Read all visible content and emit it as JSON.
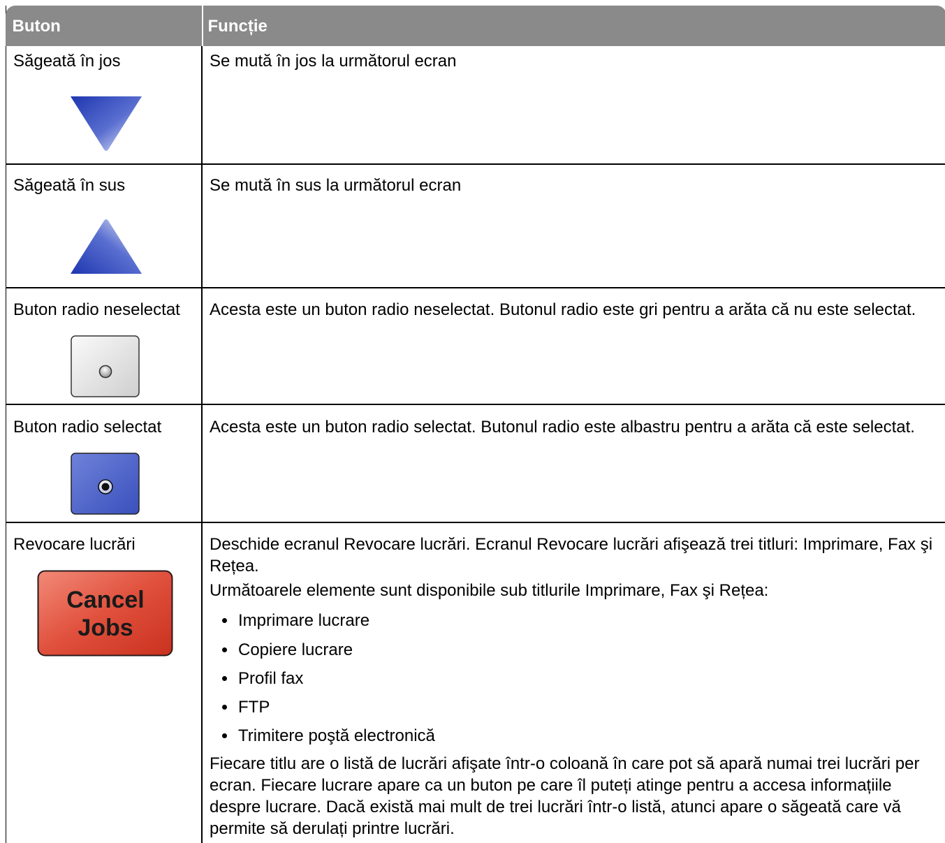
{
  "table": {
    "headers": [
      "Buton",
      "Funcție"
    ],
    "rows": [
      {
        "button_label": "Săgeată în jos",
        "icon": "arrow-down-icon",
        "function": [
          "Se mută în jos la următorul ecran"
        ]
      },
      {
        "button_label": "Săgeată în sus",
        "icon": "arrow-up-icon",
        "function": [
          "Se mută în sus la următorul ecran"
        ]
      },
      {
        "button_label": "Buton radio neselectat",
        "icon": "radio-unselected-icon",
        "function": [
          "Acesta este un buton radio neselectat. Butonul radio este gri pentru a arăta că nu este selectat."
        ]
      },
      {
        "button_label": "Buton radio selectat",
        "icon": "radio-selected-icon",
        "function": [
          "Acesta este un buton radio selectat. Butonul radio este albastru pentru a arăta că este selectat."
        ]
      },
      {
        "button_label": "Revocare lucrări",
        "icon": "cancel-jobs-icon",
        "icon_text": [
          "Cancel",
          "Jobs"
        ],
        "function": [
          "Deschide ecranul Revocare lucrări. Ecranul Revocare lucrări afişează trei titluri: Imprimare, Fax şi Rețea.",
          "Următoarele elemente sunt disponibile sub titlurile Imprimare, Fax şi Rețea:",
          "Fiecare titlu are o listă de lucrări afişate într-o coloană în care pot să apară numai trei lucrări per ecran. Fiecare lucrare apare ca un buton pe care îl puteți atinge pentru a accesa informațiile despre lucrare. Dacă există mai mult de trei lucrări într-o listă, atunci apare o săgeată care vă permite să derulați printre lucrări."
        ],
        "bullets": [
          "Imprimare lucrare",
          "Copiere lucrare",
          "Profil fax",
          "FTP",
          "Trimitere poştă electronică"
        ]
      }
    ]
  },
  "colors": {
    "header_bg": "#8a8a8a",
    "arrow_blue": "#2d45b8",
    "radio_selected_bg": "#4a5fc8",
    "cancel_red": "#d23a2a"
  }
}
